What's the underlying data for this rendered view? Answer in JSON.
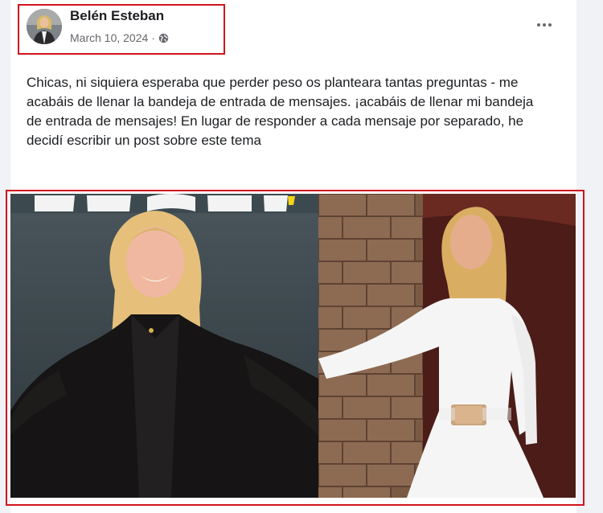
{
  "post": {
    "author": {
      "name": "Belén Esteban",
      "avatar_icon": "profile-photo"
    },
    "date": "March 10, 2024",
    "separator": "·",
    "audience_icon": "globe-icon",
    "more_icon": "more-options-icon",
    "text": "Chicas, ni siquiera esperaba que perder peso os planteara tantas preguntas - me acabáis de llenar la bandeja de entrada de mensajes. ¡acabáis de llenar mi bandeja de entrada de mensajes! En lugar de responder a cada mensaje por separado, he decidí escribir un post sobre este tema",
    "images": [
      {
        "name": "before-photo",
        "description_icon": "woman-black-blouse-photo"
      },
      {
        "name": "after-photo",
        "description_icon": "woman-white-dress-photo"
      }
    ]
  },
  "colors": {
    "highlight_border": "#d0141b",
    "text_primary": "#1c1e21",
    "text_secondary": "#65676b",
    "card_background": "#ffffff",
    "page_background": "#f0f2f5"
  }
}
